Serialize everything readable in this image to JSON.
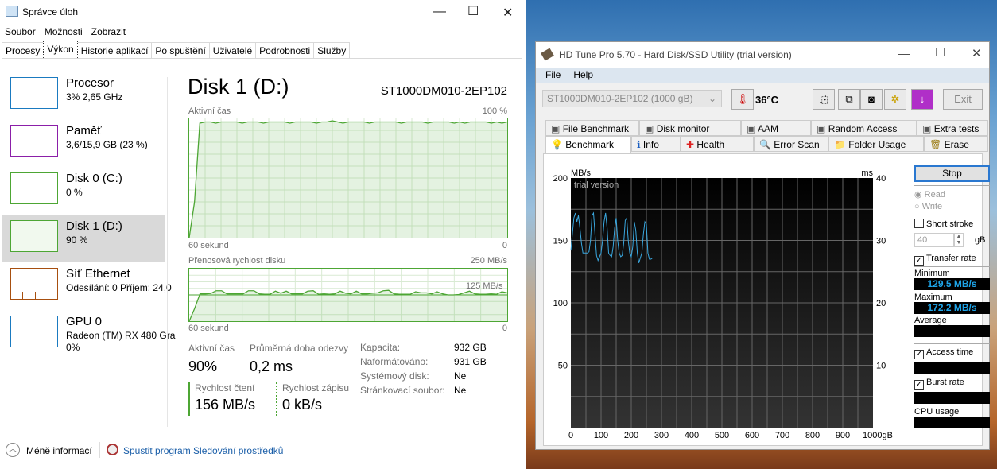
{
  "taskmgr": {
    "title": "Správce úloh",
    "menu": [
      "Soubor",
      "Možnosti",
      "Zobrazit"
    ],
    "tabs": [
      "Procesy",
      "Výkon",
      "Historie aplikací",
      "Po spuštění",
      "Uživatelé",
      "Podrobnosti",
      "Služby"
    ],
    "sidebar": [
      {
        "name": "Procesor",
        "sub": "3% 2,65 GHz",
        "color": "#1a7ac0"
      },
      {
        "name": "Paměť",
        "sub": "3,6/15,9 GB (23 %)",
        "color": "#8b1fa8"
      },
      {
        "name": "Disk 0 (C:)",
        "sub": "0 %",
        "color": "#4da634"
      },
      {
        "name": "Disk 1 (D:)",
        "sub": "90 %",
        "color": "#4da634"
      },
      {
        "name": "Síť Ethernet",
        "sub": "Odesílání: 0 Příjem: 24,0",
        "color": "#a74f0f"
      },
      {
        "name": "GPU 0",
        "sub": "Radeon (TM) RX 480 Gra",
        "sub2": "0%",
        "color": "#1a7ac0"
      }
    ],
    "main": {
      "title": "Disk 1 (D:)",
      "model": "ST1000DM010-2EP102",
      "chart1": {
        "label": "Aktivní čas",
        "max": "100 %",
        "left": "60 sekund",
        "right": "0",
        "values": [
          0,
          30,
          96,
          97,
          97,
          96,
          97,
          97,
          97,
          97,
          96,
          97,
          97,
          97,
          96,
          97,
          97,
          97,
          97,
          96,
          97,
          97,
          97,
          97,
          96,
          97,
          97,
          98,
          97,
          96,
          97,
          97,
          97,
          97,
          96,
          97,
          97,
          97,
          97,
          97,
          96,
          97,
          97,
          97,
          97,
          96,
          97,
          97,
          97,
          97,
          96,
          97,
          96,
          97,
          97,
          97,
          97,
          96,
          97,
          96,
          97
        ]
      },
      "chart2": {
        "label": "Přenosová rychlost disku",
        "max": "250 MB/s",
        "mid": "125 MB/s",
        "left": "60 sekund",
        "right": "0",
        "values": [
          0,
          60,
          130,
          130,
          132,
          145,
          145,
          130,
          130,
          130,
          130,
          145,
          145,
          130,
          128,
          128,
          143,
          133,
          143,
          130,
          130,
          130,
          143,
          145,
          128,
          130,
          128,
          130,
          143,
          133,
          130,
          143,
          130,
          130,
          133,
          135,
          145,
          147,
          130,
          128,
          128,
          128,
          140,
          135,
          135,
          130,
          140,
          130,
          125,
          125,
          127,
          135,
          143,
          130,
          128,
          128,
          130,
          128,
          140,
          135
        ]
      },
      "stats": {
        "active_label": "Aktivní čas",
        "active": "90%",
        "resp_label": "Průměrná doba odezvy",
        "resp": "0,2 ms",
        "read_label": "Rychlost čtení",
        "read": "156 MB/s",
        "write_label": "Rychlost zápisu",
        "write": "0 kB/s"
      },
      "props": [
        [
          "Kapacita:",
          "932 GB"
        ],
        [
          "Naformátováno:",
          "931 GB"
        ],
        [
          "Systémový disk:",
          "Ne"
        ],
        [
          "Stránkovací soubor:",
          "Ne"
        ]
      ]
    },
    "footer": {
      "less": "Méně informací",
      "monitor": "Spustit program Sledování prostředků"
    }
  },
  "hdtune": {
    "title": "HD Tune Pro 5.70 - Hard Disk/SSD Utility (trial version)",
    "menu": [
      "File",
      "Help"
    ],
    "drive": "ST1000DM010-2EP102 (1000 gB)",
    "temp": "36°C",
    "exit": "Exit",
    "tabs_top": [
      "File Benchmark",
      "Disk monitor",
      "AAM",
      "Random Access",
      "Extra tests"
    ],
    "tabs_bottom": [
      "Benchmark",
      "Info",
      "Health",
      "Error Scan",
      "Folder Usage",
      "Erase"
    ],
    "side": {
      "stop": "Stop",
      "read": "Read",
      "write": "Write",
      "short_stroke": "Short stroke",
      "stroke_val": "40",
      "stroke_unit": "gB",
      "transfer_rate": "Transfer rate",
      "minimum": "Minimum",
      "min_val": "129.5 MB/s",
      "maximum": "Maximum",
      "max_val": "172.2 MB/s",
      "average": "Average",
      "access_time": "Access time",
      "burst_rate": "Burst rate",
      "cpu_usage": "CPU usage"
    },
    "colors": {
      "line": "#3aa8e0",
      "value_text": "#1ea4e8"
    }
  },
  "chart_data": {
    "type": "line",
    "title": "trial version",
    "ylabel": "MB/s",
    "y2label": "ms",
    "xlabel": "gB",
    "xlim": [
      0,
      1000
    ],
    "ylim": [
      0,
      200
    ],
    "y2lim": [
      0,
      40
    ],
    "xticks": [
      "0",
      "100",
      "200",
      "300",
      "400",
      "500",
      "600",
      "700",
      "800",
      "900",
      "1000gB"
    ],
    "yticks": [
      "200",
      "150",
      "100",
      "50"
    ],
    "y2ticks": [
      "40",
      "30",
      "20",
      "10"
    ],
    "x_step": 5,
    "series": [
      {
        "name": "Transfer rate",
        "values": [
          142,
          155,
          168,
          172,
          165,
          170,
          160,
          148,
          140,
          140,
          140,
          140,
          141,
          150,
          170,
          172,
          155,
          138,
          134,
          137,
          140,
          150,
          165,
          172,
          160,
          140,
          138,
          137,
          145,
          160,
          168,
          150,
          140,
          137,
          138,
          148,
          166,
          168,
          150,
          140,
          137,
          145,
          165,
          158,
          140,
          132,
          136,
          140,
          155,
          165,
          163,
          140,
          135,
          135,
          136,
          136
        ]
      }
    ]
  }
}
